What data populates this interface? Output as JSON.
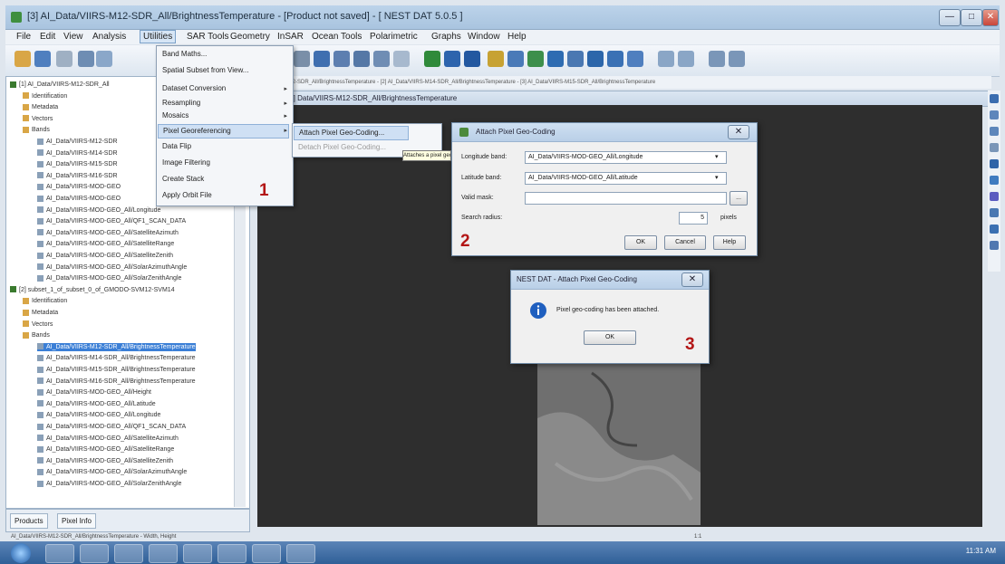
{
  "window": {
    "title": "[3] AI_Data/VIIRS-M12-SDR_All/BrightnessTemperature - [Product not saved] - [ NEST DAT 5.0.5 ]"
  },
  "menubar": {
    "items": [
      "File",
      "Edit",
      "View",
      "Analysis",
      "Utilities",
      "SAR Tools",
      "Geometry",
      "InSAR",
      "Ocean Tools",
      "Polarimetric",
      "Graphs",
      "Window",
      "Help"
    ]
  },
  "utilities_menu": {
    "items": [
      "Band Maths...",
      "Spatial Subset from View...",
      "Dataset Conversion",
      "Resampling",
      "Mosaics",
      "Pixel Georeferencing",
      "Data Flip",
      "Image Filtering",
      "Create Stack",
      "Apply Orbit File"
    ]
  },
  "submenu": {
    "items": [
      "Attach Pixel Geo-Coding...",
      "Detach Pixel Geo-Coding..."
    ],
    "tooltip": "Attaches a pixel geo-coding"
  },
  "product_tree": {
    "rows": [
      "[1] AI_Data/VIIRS-M12-SDR_All",
      "Identification",
      "Metadata",
      "Vectors",
      "Bands",
      "AI_Data/VIIRS-M12-SDR",
      "AI_Data/VIIRS-M14-SDR",
      "AI_Data/VIIRS-M15-SDR",
      "AI_Data/VIIRS-M16-SDR",
      "AI_Data/VIIRS-MOD-GEO",
      "AI_Data/VIIRS-MOD-GEO",
      "AI_Data/VIIRS-MOD-GEO_All/Longitude",
      "AI_Data/VIIRS-MOD-GEO_All/QF1_SCAN_DATA",
      "AI_Data/VIIRS-MOD-GEO_All/SatelliteAzimuth",
      "AI_Data/VIIRS-MOD-GEO_All/SatelliteRange",
      "AI_Data/VIIRS-MOD-GEO_All/SatelliteZenith",
      "AI_Data/VIIRS-MOD-GEO_All/SolarAzimuthAngle",
      "AI_Data/VIIRS-MOD-GEO_All/SolarZenithAngle",
      "[2] subset_1_of_subset_0_of_GMODO-SVM12-SVM14",
      "Identification",
      "Metadata",
      "Vectors",
      "Bands",
      "AI_Data/VIIRS-M12-SDR_All/BrightnessTemperature",
      "AI_Data/VIIRS-M14-SDR_All/BrightnessTemperature",
      "AI_Data/VIIRS-M15-SDR_All/BrightnessTemperature",
      "AI_Data/VIIRS-M16-SDR_All/BrightnessTemperature",
      "AI_Data/VIIRS-MOD-GEO_All/Height",
      "AI_Data/VIIRS-MOD-GEO_All/Latitude",
      "AI_Data/VIIRS-MOD-GEO_All/Longitude",
      "AI_Data/VIIRS-MOD-GEO_All/QF1_SCAN_DATA",
      "AI_Data/VIIRS-MOD-GEO_All/SatelliteAzimuth",
      "AI_Data/VIIRS-MOD-GEO_All/SatelliteRange",
      "AI_Data/VIIRS-MOD-GEO_All/SatelliteZenith",
      "AI_Data/VIIRS-MOD-GEO_All/SolarAzimuthAngle",
      "AI_Data/VIIRS-MOD-GEO_All/SolarZenithAngle"
    ],
    "selected_index": 23,
    "tabs": [
      "Products",
      "Pixel Info"
    ]
  },
  "view": {
    "path": "[1] Data/VIIRS-M12-SDR_All/BrightnessTemperature - [2] AI_Data/VIIRS-M14-SDR_All/BrightnessTemperature - [3] AI_Data/VIIRS-M15-SDR_All/BrightnessTemperature",
    "tab_title": "[3] Data/VIIRS-M12-SDR_All/BrightnessTemperature"
  },
  "attach_dialog": {
    "title": "Attach Pixel Geo-Coding",
    "longitude_label": "Longitude band:",
    "longitude_value": "AI_Data/VIIRS-MOD-GEO_All/Longitude",
    "latitude_label": "Latitude band:",
    "latitude_value": "AI_Data/VIIRS-MOD-GEO_All/Latitude",
    "valid_mask_label": "Valid mask:",
    "valid_mask_value": "",
    "browse_label": "...",
    "search_radius_label": "Search radius:",
    "search_radius_value": "5",
    "search_radius_unit": "pixels",
    "ok_label": "OK",
    "cancel_label": "Cancel",
    "help_label": "Help"
  },
  "info_dialog": {
    "title": "NEST DAT - Attach Pixel Geo-Coding",
    "message": "Pixel geo-coding has been attached.",
    "ok_label": "OK"
  },
  "annotations": {
    "step1": "1",
    "step2": "2",
    "step3": "3"
  },
  "statusbar": {
    "text": "AI_Data/VIIRS-M12-SDR_All/BrightnessTemperature - Width, Height",
    "zoom": "1:1"
  },
  "taskbar": {
    "clock": "11:31 AM"
  },
  "colors": {
    "selection": "#3b7fd6",
    "step_marker": "#b31616",
    "canvas": "#2e2e2e",
    "taskbar": "#2f5f97"
  }
}
